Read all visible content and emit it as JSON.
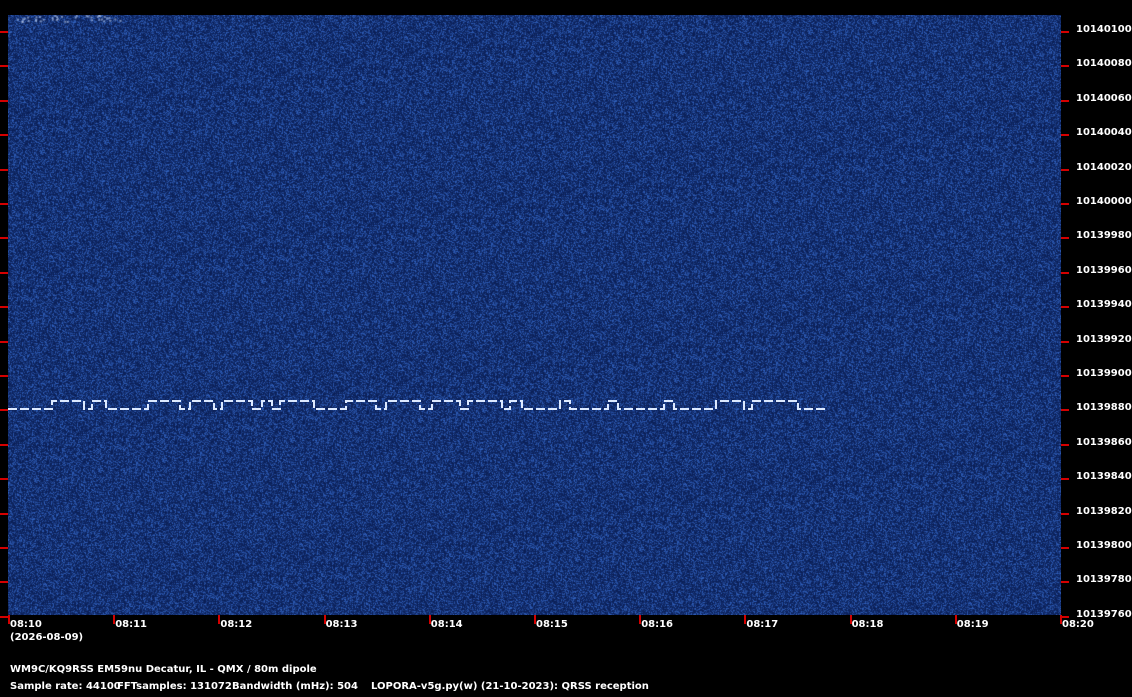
{
  "spectrogram": {
    "background_color": "#0e2a63",
    "signal_color": "#dce9ff",
    "tick_color": "#d40000",
    "y_axis_labels": [
      "10140100",
      "10140080",
      "10140060",
      "10140040",
      "10140020",
      "10140000",
      "10139980",
      "10139960",
      "10139940",
      "10139920",
      "10139900",
      "10139880",
      "10139860",
      "10139840",
      "10139820",
      "10139800",
      "10139780",
      "10139760"
    ],
    "x_axis_labels": [
      "08:10",
      "08:11",
      "08:12",
      "08:13",
      "08:14",
      "08:15",
      "08:16",
      "08:17",
      "08:18",
      "08:19",
      "08:20"
    ],
    "date_label": "(2026-08-09)"
  },
  "footer": {
    "station": "WM9C/KQ9RSS EM59nu Decatur, IL - QMX / 80m dipole",
    "sample_rate": "Sample rate: 44100",
    "fft_samples": "FFTsamples: 131072",
    "bandwidth": "Bandwidth (mHz): 504",
    "software": "LOPORA-v5g.py(w) (21-10-2023): QRSS reception"
  }
}
